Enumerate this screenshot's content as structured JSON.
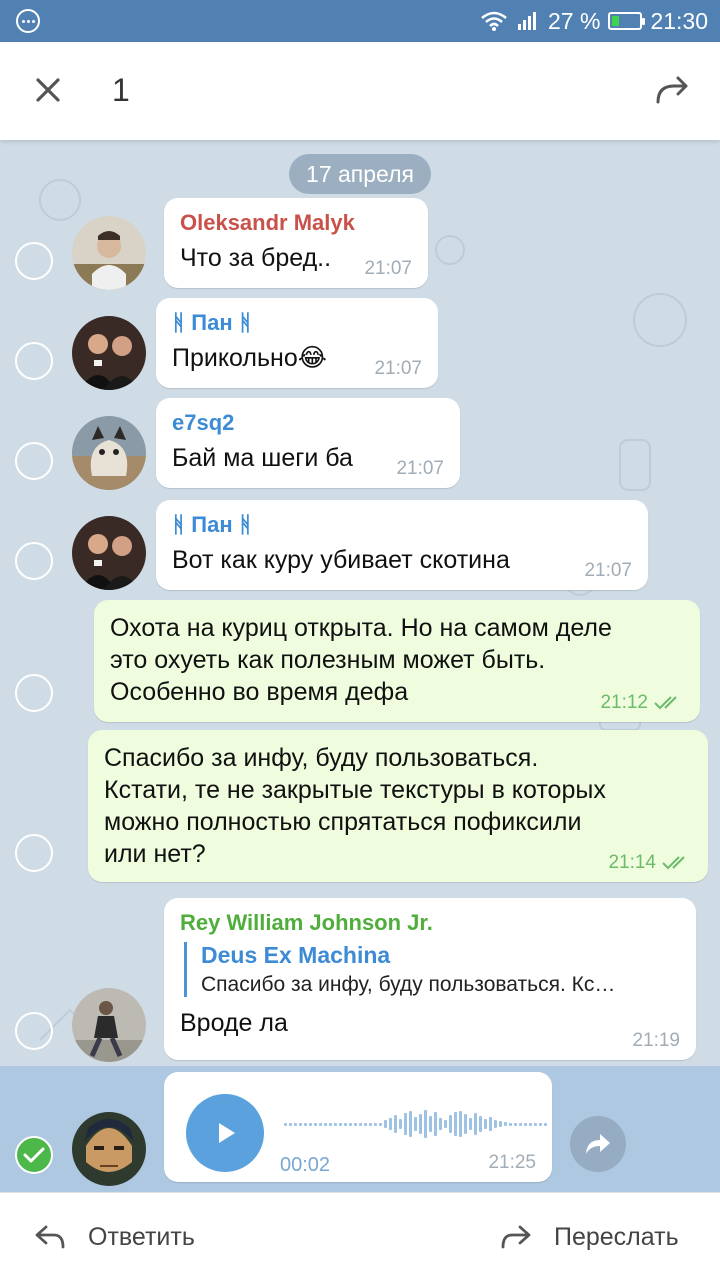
{
  "status_bar": {
    "battery": "27 %",
    "battery_level": 0.27,
    "time": "21:30"
  },
  "header": {
    "selected_count": "1"
  },
  "chat": {
    "date": "17 апреля",
    "messages": [
      {
        "sender": "Oleksandr Malyk",
        "sender_color": "#c8514a",
        "text": "Что за бред..",
        "time": "21:07",
        "outgoing": false
      },
      {
        "sender": "ᚻ Пан ᚻ",
        "sender_color": "#3d8bd5",
        "text": "Прикольно😂",
        "time": "21:07",
        "outgoing": false
      },
      {
        "sender": "e7sq2",
        "sender_color": "#3d8bd5",
        "text": "Бай ма шеги ба",
        "time": "21:07",
        "outgoing": false
      },
      {
        "sender": "ᚻ Пан ᚻ",
        "sender_color": "#3d8bd5",
        "text": "Вот как куру убивает скотина",
        "time": "21:07",
        "outgoing": false
      },
      {
        "text_lines": [
          "Охота на куриц открыта. Но на самом деле",
          "это охуеть как полезным может быть.",
          "Особенно во время дефа"
        ],
        "time": "21:12",
        "outgoing": true
      },
      {
        "text_lines": [
          "Спасибо за инфу, буду пользоваться.",
          "Кстати, те не закрытые текстуры в которых",
          "можно полностью спрятаться пофиксили",
          "или нет?"
        ],
        "time": "21:14",
        "outgoing": true
      },
      {
        "sender": "Rey William Johnson Jr.",
        "sender_color": "#4fae3b",
        "reply_name": "Deus Ex Machina",
        "reply_text": "Спасибо за инфу, буду пользоваться. Кс…",
        "text": "Вроде ла",
        "time": "21:19",
        "outgoing": false
      },
      {
        "type": "voice",
        "duration": "00:02",
        "time": "21:25",
        "outgoing": false,
        "selected": true
      }
    ]
  },
  "bottom_bar": {
    "reply_label": "Ответить",
    "forward_label": "Переслать"
  },
  "icons": [
    "close-icon",
    "forward-icon",
    "play-icon",
    "reply-icon",
    "checkmark-icon",
    "double-check-icon"
  ]
}
